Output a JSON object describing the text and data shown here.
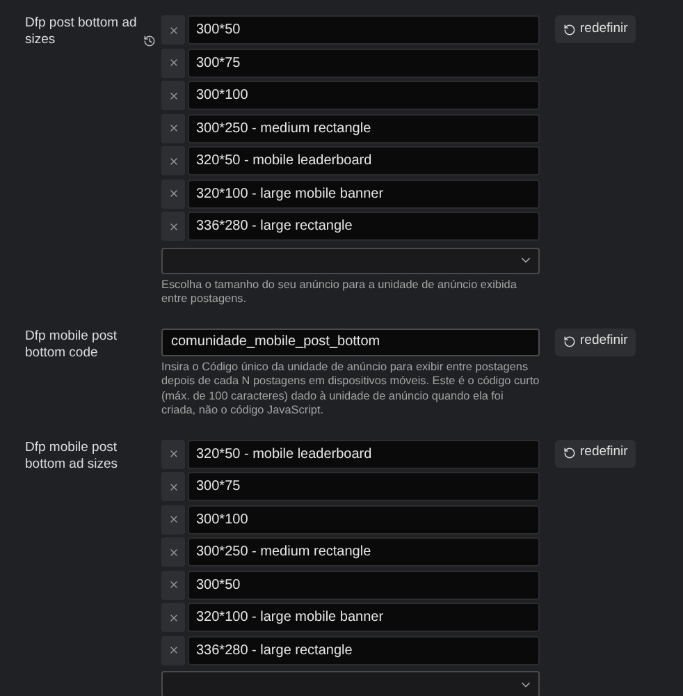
{
  "settings": [
    {
      "kind": "list",
      "label": "Dfp post bottom ad sizes",
      "modified": true,
      "values": [
        "300*50",
        "300*75",
        "300*100",
        "300*250 - medium rectangle",
        "320*50 - mobile leaderboard",
        "320*100 - large mobile banner",
        "336*280 - large rectangle"
      ],
      "help": "Escolha o tamanho do seu anúncio para a unidade de anúncio exibida entre postagens.",
      "reset": "redefinir"
    },
    {
      "kind": "text",
      "label": "Dfp mobile post bottom code",
      "modified": false,
      "value": "comunidade_mobile_post_bottom",
      "help": "Insira o Código único da unidade de anúncio para exibir entre postagens depois de cada N postagens em dispositivos móveis. Este é o código curto (máx. de 100 caracteres) dado à unidade de anúncio quando ela foi criada, não o código JavaScript.",
      "reset": "redefinir"
    },
    {
      "kind": "list",
      "label": "Dfp mobile post bottom ad sizes",
      "modified": false,
      "values": [
        "320*50 - mobile leaderboard",
        "300*75",
        "300*100",
        "300*250 - medium rectangle",
        "300*50",
        "320*100 - large mobile banner",
        "336*280 - large rectangle"
      ],
      "reset": "redefinir"
    }
  ]
}
